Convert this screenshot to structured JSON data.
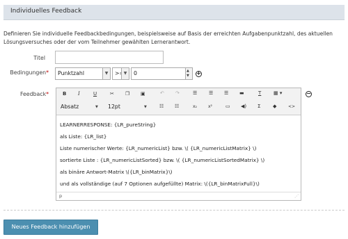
{
  "header": {
    "title": "Individuelles Feedback"
  },
  "description": "Definieren Sie individuelle Feedbackbedingungen, beispielsweise auf Basis der erreichten Aufgabenpunktzahl, des aktuellen Lösungsversuches oder der vom Teilnehmer gewählten Lernerantwort.",
  "form": {
    "title_label": "Titel",
    "title_value": "",
    "conditions_label": "Bedingungen",
    "condition_type": "Punktzahl",
    "condition_operator": ">=",
    "condition_value": "0",
    "feedback_label": "Feedback",
    "required_mark": "*"
  },
  "editor": {
    "toolbar_icons": [
      "bold-icon",
      "italic-icon",
      "underline-icon",
      "cut-icon",
      "copy-icon",
      "paste-icon",
      "undo-icon",
      "redo-icon",
      "align-left-icon",
      "align-center-icon",
      "align-right-icon",
      "justify-icon",
      "clear-format-icon",
      "table-icon",
      "format-select",
      "font-size-select",
      "bullet-list-icon",
      "numbered-list-icon",
      "subscript-icon",
      "superscript-icon",
      "image-icon",
      "media-icon",
      "sum-icon",
      "insert-icon",
      "code-icon"
    ],
    "format_label": "Absatz",
    "size_label": "12pt",
    "bold": "B",
    "italic": "I",
    "underline": "U",
    "subscript": "x₂",
    "superscript": "x²",
    "sum": "Σ",
    "code": "<>",
    "status_path": "p",
    "lines": [
      "LEARNERRESPONSE: {LR_pureString}",
      "als Liste: {LR_list}",
      "Liste numerischer Werte: {LR_numericList} bzw. \\( {LR_numericListMatrix} \\)",
      "sortierte Liste : {LR_numericListSorted} bzw. \\( {LR_numericListSortedMatrix} \\)",
      "als binäre Antwort-Matrix \\({LR_binMatrix}\\)",
      "und als vollständige (auf 7 Optionen aufgefüllte) Matrix: \\({LR_binMatrixFull}\\)"
    ]
  },
  "actions": {
    "add_feedback": "Neues Feedback hinzufügen"
  },
  "colors": {
    "primary": "#4c8fb0",
    "header_bg": "#dde3ea"
  }
}
